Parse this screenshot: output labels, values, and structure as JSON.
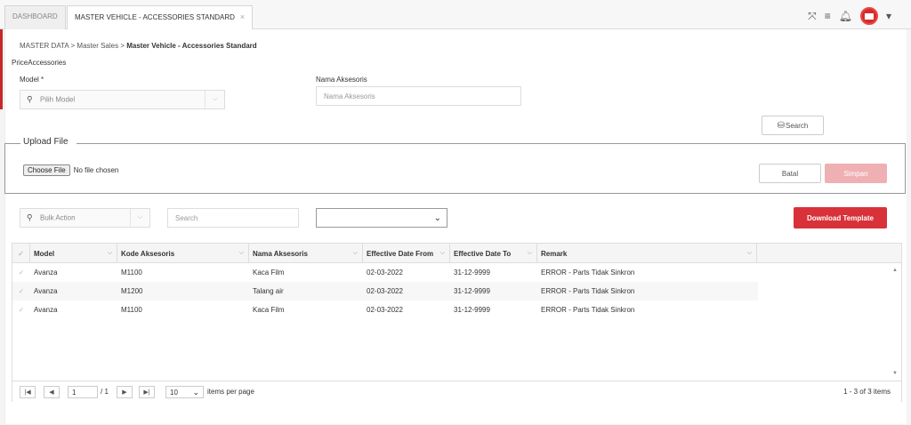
{
  "tabs": [
    {
      "label": "DASHBOARD"
    },
    {
      "label": "MASTER VEHICLE - ACCESSORIES STANDARD",
      "close": "×"
    }
  ],
  "breadcrumb": {
    "part1": "MASTER DATA",
    "part2": "Master Sales",
    "part3": "Master Vehicle - Accessories Standard",
    "sep": ">"
  },
  "section_title": "PriceAccessories",
  "filters": {
    "model_label": "Model *",
    "model_placeholder": "Pilih Model",
    "nama_label": "Nama Aksesoris",
    "nama_placeholder": "Nama Aksesoris",
    "search_button": "Search"
  },
  "upload": {
    "legend": "Upload File",
    "choose_button": "Choose File",
    "no_file": "No file chosen",
    "batal": "Batal",
    "simpan": "Simpan"
  },
  "toolbar": {
    "bulk_action": "Bulk Action",
    "search_placeholder": "Search",
    "download_template": "Download Template"
  },
  "grid": {
    "columns": [
      "Model",
      "Kode Aksesoris",
      "Nama Aksesoris",
      "Effective Date From",
      "Effective Date To",
      "Remark"
    ],
    "rows": [
      [
        "Avanza",
        "M1100",
        "Kaca Film",
        "02-03-2022",
        "31-12-9999",
        "ERROR - Parts Tidak Sinkron"
      ],
      [
        "Avanza",
        "M1200",
        "Talang air",
        "02-03-2022",
        "31-12-9999",
        "ERROR - Parts Tidak Sinkron"
      ],
      [
        "Avanza",
        "M1100",
        "Kaca Film",
        "02-03-2022",
        "31-12-9999",
        "ERROR - Parts Tidak Sinkron"
      ]
    ]
  },
  "pager": {
    "page": "1",
    "total_pages": "/ 1",
    "page_size": "10",
    "items_per_page": "items per page",
    "summary": "1 - 3 of 3 items"
  },
  "colors": {
    "accent": "#d8313a",
    "accent_disabled": "#efb0b4"
  }
}
